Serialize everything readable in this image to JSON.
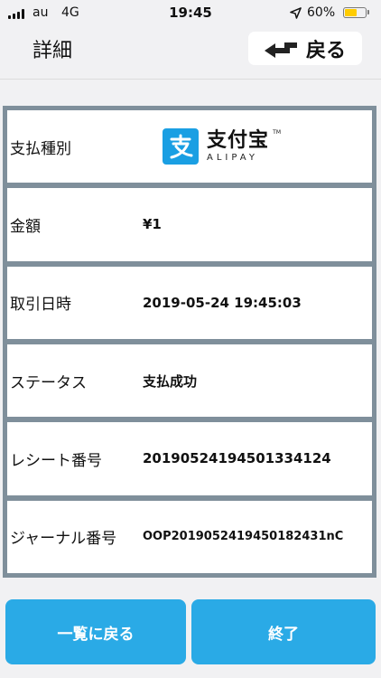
{
  "status_bar": {
    "carrier": "au",
    "network": "4G",
    "time": "19:45",
    "battery_percent": "60%",
    "battery_level": 0.6,
    "icons": [
      "signal-bars-icon",
      "location-arrow-icon",
      "battery-icon"
    ]
  },
  "nav": {
    "title": "詳細",
    "back_label": "戻る",
    "back_icon": "return-arrow-icon"
  },
  "logo": {
    "name_cn": "支付宝",
    "name_en": "ALIPAY",
    "tm": "TM",
    "icon": "alipay-logo-icon",
    "brand_color": "#1a9fe3"
  },
  "details": [
    {
      "label": "支払種別",
      "value": ""
    },
    {
      "label": "金額",
      "value": "¥1"
    },
    {
      "label": "取引日時",
      "value": "2019-05-24 19:45:03"
    },
    {
      "label": "ステータス",
      "value": "支払成功"
    },
    {
      "label": "レシート番号",
      "value": "20190524194501334124"
    },
    {
      "label": "ジャーナル番号",
      "value": "OOP2019052419450182431nC"
    }
  ],
  "footer": {
    "back_to_list": "一覧に戻る",
    "finish": "終了"
  },
  "colors": {
    "accent": "#2aaae6",
    "table_border": "#7f8f9b",
    "background": "#f1f1f3",
    "battery": "#ffcc00"
  }
}
